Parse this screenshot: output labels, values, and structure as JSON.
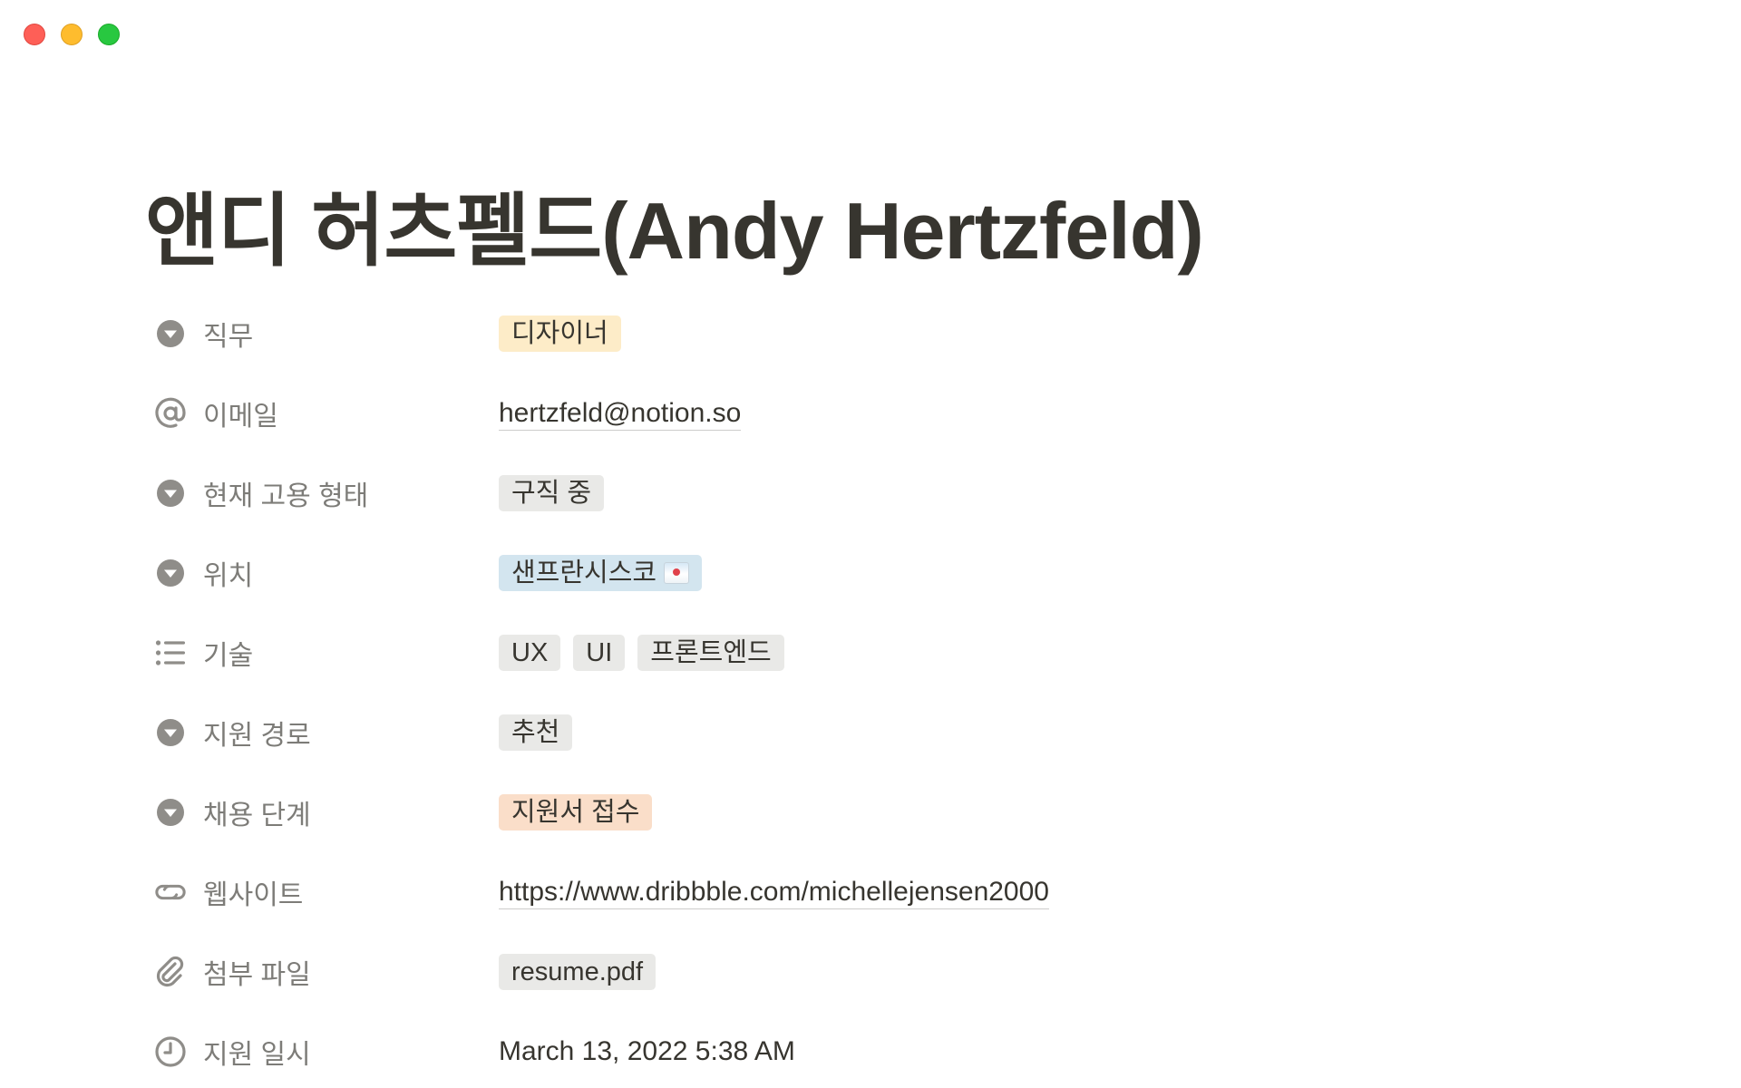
{
  "window": {
    "controls": [
      "close",
      "minimize",
      "zoom"
    ]
  },
  "page": {
    "title": "앤디 허츠펠드(Andy Hertzfeld)"
  },
  "properties": [
    {
      "label": "직무",
      "icon": "select-icon",
      "type": "select",
      "tags": [
        {
          "text": "디자이너",
          "color": "#fdecc8"
        }
      ]
    },
    {
      "label": "이메일",
      "icon": "at-sign-icon",
      "type": "email",
      "value": "hertzfeld@notion.so"
    },
    {
      "label": "현재 고용 형태",
      "icon": "select-icon",
      "type": "select",
      "tags": [
        {
          "text": "구직 중",
          "color": "#e9e9e7"
        }
      ]
    },
    {
      "label": "위치",
      "icon": "select-icon",
      "type": "select",
      "tags": [
        {
          "text": "샌프란시스코",
          "color": "#d3e5ef",
          "emoji": "bridge-image-icon"
        }
      ]
    },
    {
      "label": "기술",
      "icon": "multi-select-icon",
      "type": "multi_select",
      "tags": [
        {
          "text": "UX",
          "color": "#e9e9e7"
        },
        {
          "text": "UI",
          "color": "#e9e9e7"
        },
        {
          "text": "프론트엔드",
          "color": "#e9e9e7"
        }
      ]
    },
    {
      "label": "지원 경로",
      "icon": "select-icon",
      "type": "select",
      "tags": [
        {
          "text": "추천",
          "color": "#e9e9e7"
        }
      ]
    },
    {
      "label": "채용 단계",
      "icon": "select-icon",
      "type": "select",
      "tags": [
        {
          "text": "지원서 접수",
          "color": "#fadec9"
        }
      ]
    },
    {
      "label": "웹사이트",
      "icon": "link-icon",
      "type": "url",
      "value": "https://www.dribbble.com/michellejensen2000"
    },
    {
      "label": "첨부 파일",
      "icon": "paperclip-icon",
      "type": "file",
      "tags": [
        {
          "text": "resume.pdf",
          "color": "#e9e9e7"
        }
      ]
    },
    {
      "label": "지원 일시",
      "icon": "clock-icon",
      "type": "created_time",
      "value": "March 13, 2022 5:38 AM"
    }
  ]
}
